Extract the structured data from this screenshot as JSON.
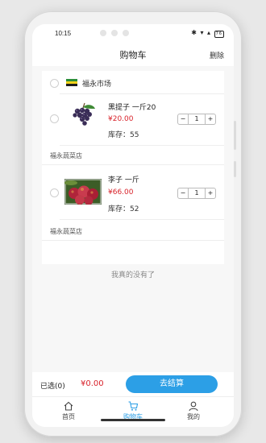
{
  "status_bar": {
    "time": "10:15",
    "icons": "✱ ▾ ▴",
    "battery": "76"
  },
  "header": {
    "title": "购物车",
    "delete_label": "删除"
  },
  "market": {
    "name": "福永市场"
  },
  "items": [
    {
      "name": "黑提子  一斤20",
      "price": "¥20.00",
      "stock": "库存：55",
      "quantity": "1",
      "store": "福永蔬菜店"
    },
    {
      "name": "李子  一斤",
      "price": "¥66.00",
      "stock": "库存：52",
      "quantity": "1",
      "store": "福永蔬菜店"
    }
  ],
  "empty_message": "我真的没有了",
  "checkout": {
    "selected_label": "已选(0)",
    "total": "¥0.00",
    "button_label": "去结算"
  },
  "tabbar": [
    {
      "label": "首页",
      "icon": "home-icon"
    },
    {
      "label": "购物车",
      "icon": "cart-icon",
      "active": true
    },
    {
      "label": "我的",
      "icon": "user-icon"
    }
  ],
  "colors": {
    "accent": "#2c9fe6",
    "price": "#d8222a"
  }
}
